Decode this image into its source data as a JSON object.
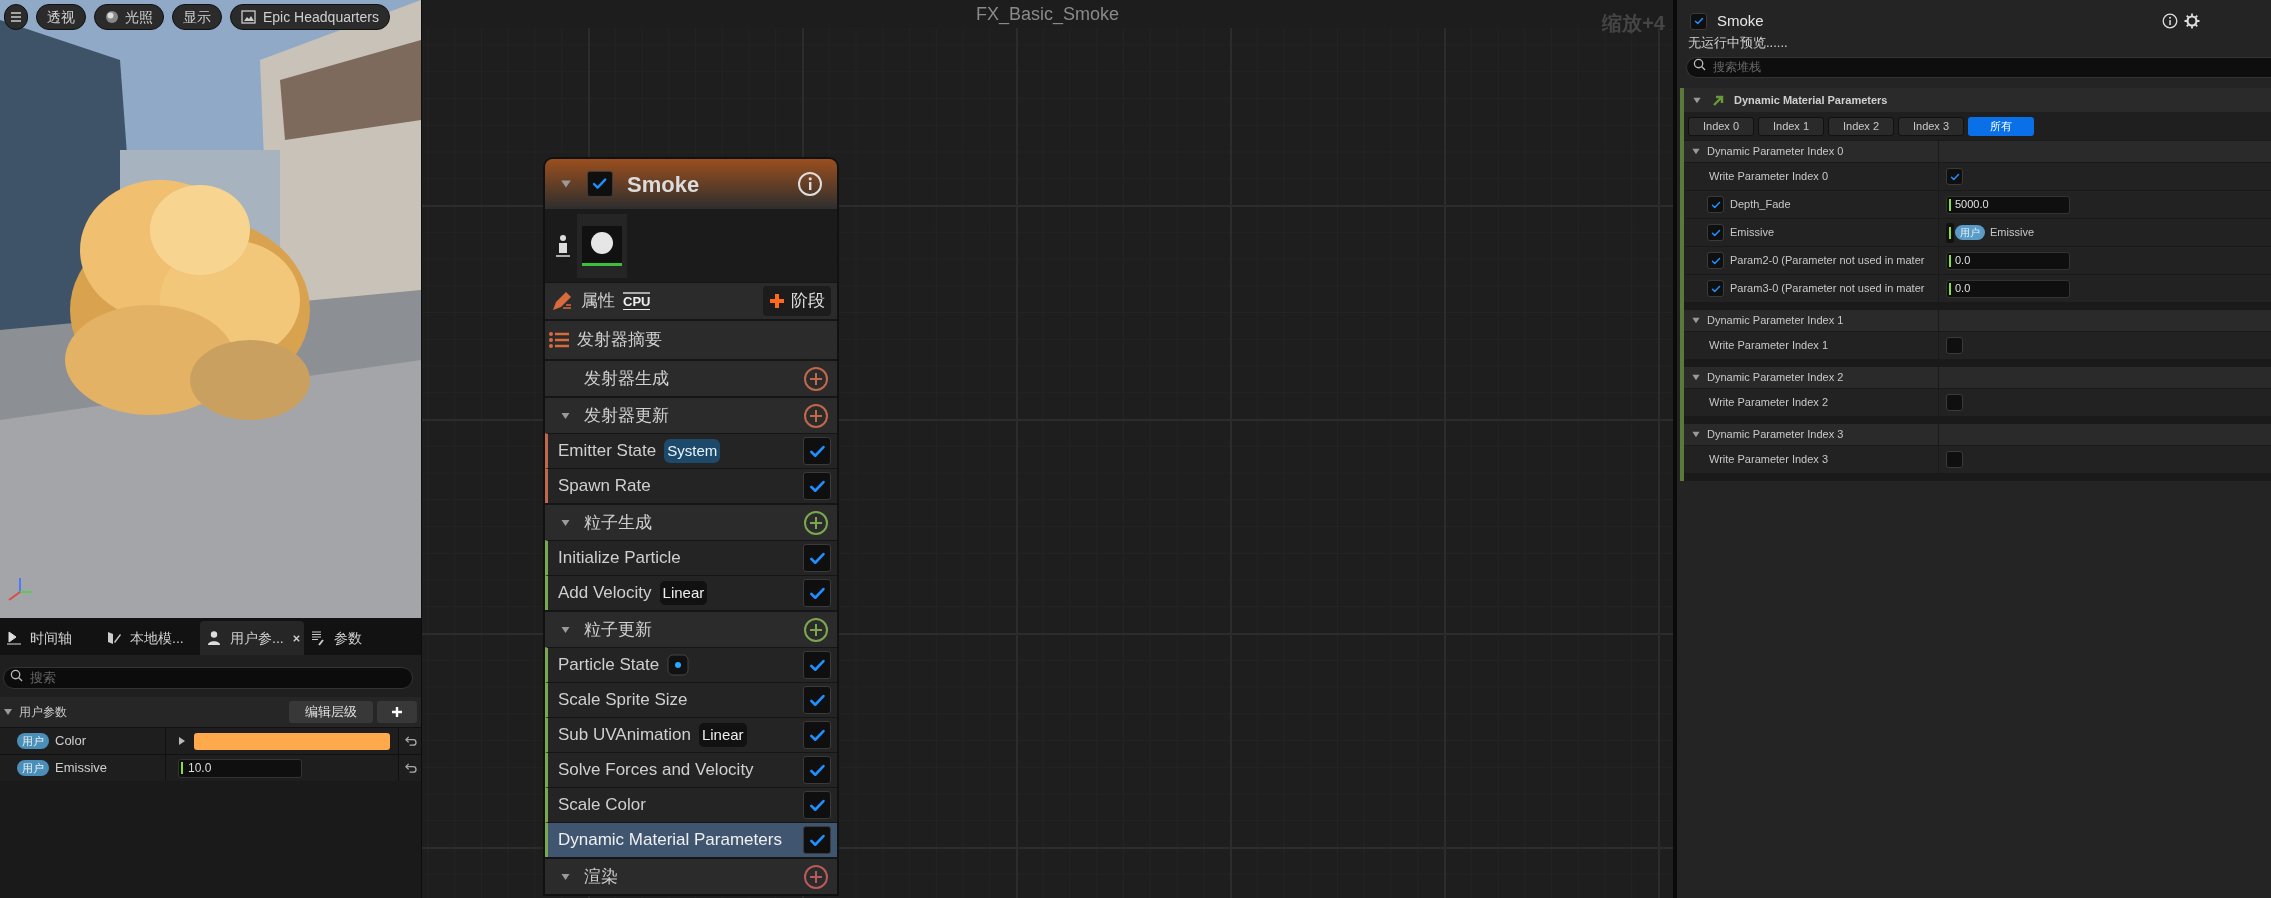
{
  "viewport": {
    "toolbar": [
      {
        "kind": "menu"
      },
      {
        "kind": "text",
        "label": "透视"
      },
      {
        "kind": "lighting",
        "label": "光照"
      },
      {
        "kind": "text",
        "label": "显示"
      },
      {
        "kind": "environment",
        "label": "Epic Headquarters"
      }
    ]
  },
  "bottom_panel": {
    "tabs": [
      {
        "label": "时间轴",
        "kind": "timeline",
        "selected": false
      },
      {
        "label": "本地模...",
        "kind": "local",
        "selected": false
      },
      {
        "label": "用户参...",
        "kind": "user",
        "selected": true
      },
      {
        "label": "参数",
        "kind": "params",
        "selected": false
      }
    ],
    "search": {
      "placeholder": "搜索"
    },
    "section": {
      "title": "用户参数",
      "expanded": true,
      "edit_button": "编辑层级"
    },
    "params": [
      {
        "badge": "用户",
        "name": "Color",
        "kind": "color",
        "color": "#ffa94d"
      },
      {
        "badge": "用户",
        "name": "Emissive",
        "kind": "number",
        "value": "10.0"
      }
    ]
  },
  "graph": {
    "title": "FX_Basic_Smoke",
    "zoom": "缩放+4",
    "node": {
      "title": "Smoke",
      "enabled": true,
      "expanded": true,
      "properties": "属性",
      "sim_target": "CPU",
      "add_stage": "阶段",
      "summary": "发射器摘要",
      "groups": [
        {
          "title": "发射器生成",
          "kind": "plain",
          "color": "#c0684a"
        },
        {
          "title": "发射器更新",
          "kind": "collapsible",
          "color": "#c0684a",
          "modules": [
            {
              "kind": "system",
              "label": "Emitter State",
              "badge": "System",
              "enabled": true,
              "selected": false
            },
            {
              "kind": "plain",
              "label": "Spawn Rate",
              "enabled": true,
              "selected": false
            }
          ]
        },
        {
          "title": "粒子生成",
          "kind": "collapsible",
          "color": "#7aa84e",
          "modules": [
            {
              "kind": "plain",
              "label": "Initialize Particle",
              "enabled": true,
              "selected": false
            },
            {
              "kind": "linear",
              "label": "Add Velocity",
              "badge": "Linear",
              "enabled": true,
              "selected": false
            }
          ]
        },
        {
          "title": "粒子更新",
          "kind": "collapsible",
          "color": "#7aa84e",
          "modules": [
            {
              "kind": "dot",
              "label": "Particle State",
              "enabled": true,
              "selected": false
            },
            {
              "kind": "plain",
              "label": "Scale Sprite Size",
              "enabled": true,
              "selected": false
            },
            {
              "kind": "linear",
              "label": "Sub UVAnimation",
              "badge": "Linear",
              "enabled": true,
              "selected": false
            },
            {
              "kind": "plain",
              "label": "Solve Forces and Velocity",
              "enabled": true,
              "selected": false
            },
            {
              "kind": "plain",
              "label": "Scale Color",
              "enabled": true,
              "selected": false
            },
            {
              "kind": "plain",
              "label": "Dynamic Material Parameters",
              "enabled": true,
              "selected": true
            }
          ]
        },
        {
          "title": "渲染",
          "kind": "collapsible",
          "color": "#b85a5a"
        }
      ]
    }
  },
  "details": {
    "title": "Smoke",
    "enabled": true,
    "status": "无运行中预览......",
    "search": {
      "placeholder": "搜索堆栈"
    },
    "module": {
      "title": "Dynamic Material Parameters",
      "expanded": true,
      "tabs": [
        {
          "label": "Index 0",
          "selected": false
        },
        {
          "label": "Index 1",
          "selected": false
        },
        {
          "label": "Index 2",
          "selected": false
        },
        {
          "label": "Index 3",
          "selected": false
        },
        {
          "label": "所有",
          "selected": true
        }
      ],
      "sections": [
        {
          "title": "Dynamic Parameter Index 0",
          "expanded": true,
          "rows": [
            {
              "kind": "toggle",
              "label": "Write Parameter Index 0",
              "checked": true
            },
            {
              "kind": "number",
              "label": "Depth_Fade",
              "enabled": true,
              "value": "5000.0"
            },
            {
              "kind": "link",
              "label": "Emissive",
              "enabled": true,
              "badge": "用户",
              "value": "Emissive"
            },
            {
              "kind": "number",
              "label": "Param2-0 (Parameter not used in mater",
              "enabled": true,
              "value": "0.0"
            },
            {
              "kind": "number",
              "label": "Param3-0 (Parameter not used in mater",
              "enabled": true,
              "value": "0.0"
            }
          ]
        },
        {
          "title": "Dynamic Parameter Index 1",
          "expanded": true,
          "rows": [
            {
              "kind": "toggle",
              "label": "Write Parameter Index 1",
              "checked": false
            }
          ]
        },
        {
          "title": "Dynamic Parameter Index 2",
          "expanded": true,
          "rows": [
            {
              "kind": "toggle",
              "label": "Write Parameter Index 2",
              "checked": false
            }
          ]
        },
        {
          "title": "Dynamic Parameter Index 3",
          "expanded": true,
          "rows": [
            {
              "kind": "toggle",
              "label": "Write Parameter Index 3",
              "checked": false
            }
          ]
        }
      ]
    }
  }
}
